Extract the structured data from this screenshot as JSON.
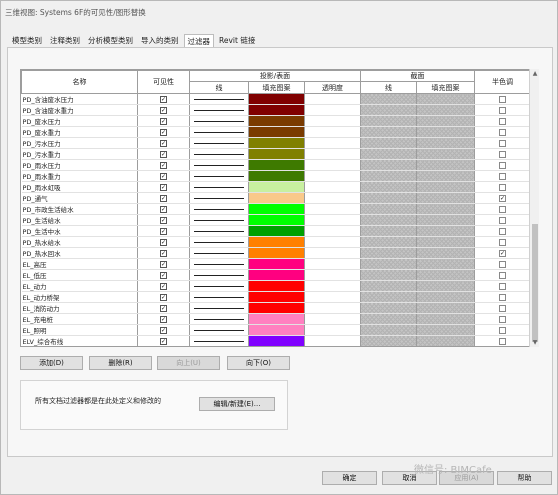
{
  "window": {
    "title": "三维视图: Systems 6F的可见性/图形替换"
  },
  "tabs": [
    {
      "label": "模型类别",
      "active": false
    },
    {
      "label": "注释类别",
      "active": false
    },
    {
      "label": "分析模型类别",
      "active": false
    },
    {
      "label": "导入的类别",
      "active": false
    },
    {
      "label": "过滤器",
      "active": true
    },
    {
      "label": "Revit 链接",
      "active": false
    }
  ],
  "table": {
    "headers": {
      "name": "名称",
      "visibility": "可见性",
      "projection": "投影/表面",
      "line": "线",
      "fill": "填充图案",
      "transparency": "透明度",
      "cut": "截面",
      "cut_line": "线",
      "cut_fill": "填充图案",
      "halftone": "半色调"
    },
    "rows": [
      {
        "name": "PD_含油废水压力",
        "visible": true,
        "color": "#800000",
        "halftone": false
      },
      {
        "name": "PD_含油废水重力",
        "visible": true,
        "color": "#800000",
        "halftone": false
      },
      {
        "name": "PD_废水压力",
        "visible": true,
        "color": "#7a3b00",
        "halftone": false
      },
      {
        "name": "PD_废水重力",
        "visible": true,
        "color": "#7a3b00",
        "halftone": false
      },
      {
        "name": "PD_污水压力",
        "visible": true,
        "color": "#808000",
        "halftone": false
      },
      {
        "name": "PD_污水重力",
        "visible": true,
        "color": "#808000",
        "halftone": false
      },
      {
        "name": "PD_雨水压力",
        "visible": true,
        "color": "#3e7a00",
        "halftone": false
      },
      {
        "name": "PD_雨水重力",
        "visible": true,
        "color": "#3e7a00",
        "halftone": false
      },
      {
        "name": "PD_雨水虹吸",
        "visible": true,
        "color": "#c8f0a0",
        "halftone": false
      },
      {
        "name": "PD_通气",
        "visible": true,
        "color": "#f9c98a",
        "halftone": true
      },
      {
        "name": "PD_市政生活给水",
        "visible": true,
        "color": "#00ff00",
        "halftone": false
      },
      {
        "name": "PD_生活给水",
        "visible": true,
        "color": "#00ff00",
        "halftone": false
      },
      {
        "name": "PD_生活中水",
        "visible": true,
        "color": "#00a000",
        "halftone": false
      },
      {
        "name": "PD_热水给水",
        "visible": true,
        "color": "#ff8000",
        "halftone": false
      },
      {
        "name": "PD_热水回水",
        "visible": true,
        "color": "#ff8000",
        "halftone": true
      },
      {
        "name": "EL_高压",
        "visible": true,
        "color": "#ff0080",
        "halftone": false
      },
      {
        "name": "EL_低压",
        "visible": true,
        "color": "#ff0080",
        "halftone": false
      },
      {
        "name": "EL_动力",
        "visible": true,
        "color": "#ff0000",
        "halftone": false
      },
      {
        "name": "EL_动力桥架",
        "visible": true,
        "color": "#ff0000",
        "halftone": false
      },
      {
        "name": "EL_消防动力",
        "visible": true,
        "color": "#ff0000",
        "halftone": false
      },
      {
        "name": "EL_充电桩",
        "visible": true,
        "color": "#ff80c0",
        "halftone": false
      },
      {
        "name": "EL_照明",
        "visible": true,
        "color": "#ff80c0",
        "halftone": false
      },
      {
        "name": "ELV_综合布线",
        "visible": true,
        "color": "#8000ff",
        "halftone": false
      },
      {
        "name": "ELV_安防",
        "visible": true,
        "color": "#5000b0",
        "halftone": false
      },
      {
        "name": "ELV_有线电视",
        "visible": true,
        "color": "#8000ff",
        "halftone": false
      }
    ]
  },
  "buttons": {
    "add": "添加(D)",
    "delete": "删除(R)",
    "up": "向上(U)",
    "down": "向下(O)",
    "edit_new": "编辑/新建(E)...",
    "ok": "确定",
    "cancel": "取消",
    "apply": "应用(A)",
    "help": "帮助"
  },
  "note": "所有文档过滤器都是在此处定义和修改的",
  "watermark": "微信号: BIMCafe"
}
